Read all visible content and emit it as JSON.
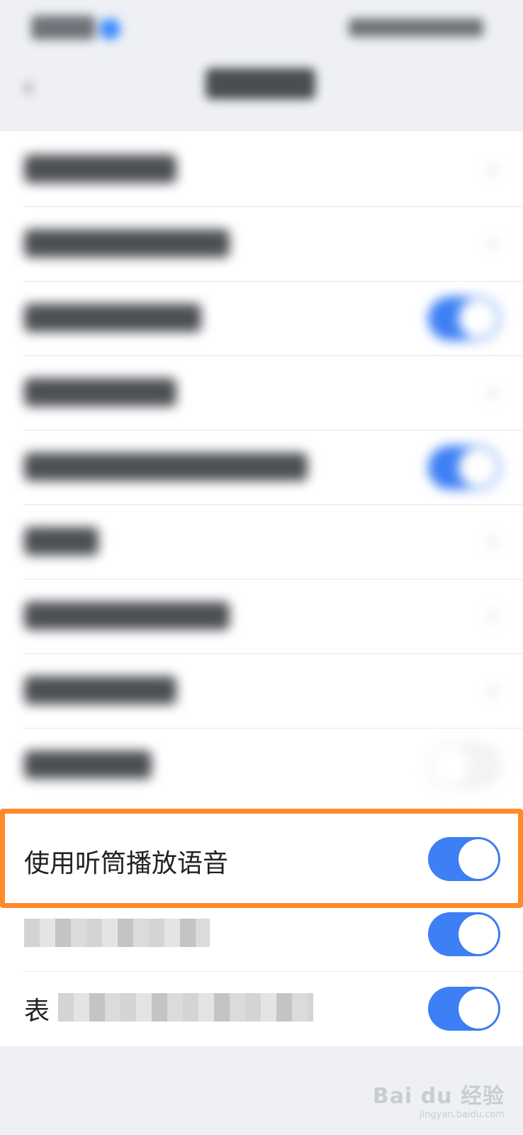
{
  "settings": {
    "rows": [
      {
        "type": "blurred-link"
      },
      {
        "type": "blurred-link"
      },
      {
        "type": "blurred-toggle",
        "on": true
      },
      {
        "type": "blurred-link"
      },
      {
        "type": "blurred-toggle",
        "on": true
      },
      {
        "type": "blurred-link"
      },
      {
        "type": "blurred-link"
      },
      {
        "type": "blurred-link"
      },
      {
        "type": "blurred-toggle",
        "on": false
      }
    ],
    "highlighted": {
      "label": "使用听筒播放语音",
      "on": true
    },
    "partial_rows": [
      {
        "visible_prefix": "",
        "on": true
      },
      {
        "visible_prefix": "表",
        "on": true
      }
    ]
  },
  "colors": {
    "toggle_on": "#3d7ff5",
    "highlight": "#ff8a2a",
    "background": "#eef0f4"
  },
  "watermark": {
    "text": "Bai du 经验",
    "sub": "jingyan.baidu.com"
  },
  "icons": {
    "back": "chevron-left-icon",
    "row_arrow": "chevron-right-icon"
  }
}
